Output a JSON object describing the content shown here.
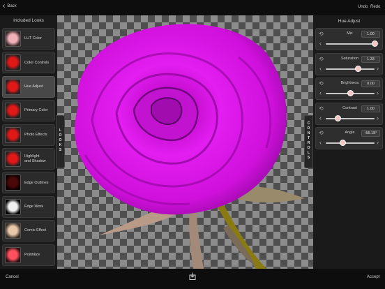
{
  "topbar": {
    "back_label": "Back",
    "undo_label": "Undo",
    "redo_label": "Redo"
  },
  "left_panel": {
    "title": "Included Looks",
    "looks": [
      {
        "label": "LUT Color",
        "thumb": "pink-rose"
      },
      {
        "label": "Color Controls",
        "thumb": "red-rose"
      },
      {
        "label": "Hue Adjust",
        "thumb": "red-rose",
        "selected": true
      },
      {
        "label": "Primary Color",
        "thumb": "red-rose"
      },
      {
        "label": "Photo Effects",
        "thumb": "red-rose"
      },
      {
        "label": "Highlight\nand Shadow",
        "thumb": "red-rose"
      },
      {
        "label": "Edge Outlines",
        "thumb": "dark-rose"
      },
      {
        "label": "Edge Work",
        "thumb": "bw-rose"
      },
      {
        "label": "Comic Effect",
        "thumb": "beige-rose"
      },
      {
        "label": "Pointilize",
        "thumb": "dotted-rose"
      }
    ],
    "tab_label": "LOOKS"
  },
  "right_panel": {
    "title": "Hue Adjust",
    "tab_label": "CONTROLS",
    "controls": [
      {
        "name": "Mix",
        "value": "1.00",
        "slider_fraction": 1.0
      },
      {
        "name": "Saturation",
        "value": "1.33",
        "slider_fraction": 0.66
      },
      {
        "name": "Brightness",
        "value": "0.00",
        "slider_fraction": 0.5
      },
      {
        "name": "Contrast",
        "value": "1.00",
        "slider_fraction": 0.25
      },
      {
        "name": "Angle",
        "value": "-55.18°",
        "slider_fraction": 0.35
      }
    ]
  },
  "bottombar": {
    "cancel_label": "Cancel",
    "accept_label": "Accept"
  },
  "colors": {
    "rose": "#e81cf0",
    "slider_knob": "#f4c7c2",
    "panel_bg": "#1a1a1a"
  }
}
